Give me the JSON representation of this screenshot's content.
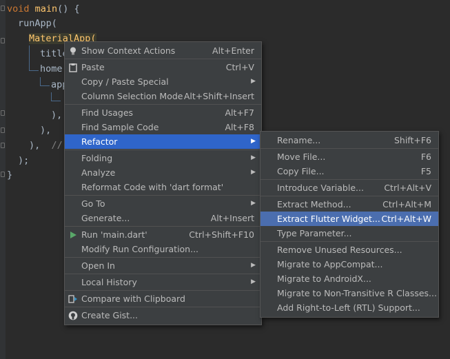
{
  "code": {
    "line1": {
      "kw": "void",
      "fn": "main",
      "rest": "() {"
    },
    "line2": "runApp(",
    "line3": "MaterialApp(",
    "line4": "title",
    "line5": "home",
    "line6": "app",
    "line7": "└",
    "line8": "),",
    "line9": "),",
    "line10": "),",
    "line10_comment": "//",
    "line11": ");",
    "line12": "}"
  },
  "context_menu": {
    "items": [
      {
        "label": "Show Context Actions",
        "shortcut": "Alt+Enter",
        "icon": "lightbulb-icon"
      },
      {
        "label": "Paste",
        "shortcut": "Ctrl+V",
        "icon": "clipboard-icon"
      },
      {
        "label": "Copy / Paste Special",
        "shortcut": ""
      },
      {
        "label": "Column Selection Mode",
        "shortcut": "Alt+Shift+Insert"
      },
      {
        "label": "Find Usages",
        "shortcut": "Alt+F7"
      },
      {
        "label": "Find Sample Code",
        "shortcut": "Alt+F8"
      },
      {
        "label": "Refactor",
        "shortcut": ""
      },
      {
        "label": "Folding",
        "shortcut": ""
      },
      {
        "label": "Analyze",
        "shortcut": ""
      },
      {
        "label": "Reformat Code with 'dart format'",
        "shortcut": ""
      },
      {
        "label": "Go To",
        "shortcut": ""
      },
      {
        "label": "Generate...",
        "shortcut": "Alt+Insert"
      },
      {
        "label": "Run 'main.dart'",
        "shortcut": "Ctrl+Shift+F10",
        "icon": "run-icon"
      },
      {
        "label": "Modify Run Configuration...",
        "shortcut": ""
      },
      {
        "label": "Open In",
        "shortcut": ""
      },
      {
        "label": "Local History",
        "shortcut": ""
      },
      {
        "label": "Compare with Clipboard",
        "shortcut": "",
        "icon": "compare-icon"
      },
      {
        "label": "Create Gist...",
        "shortcut": "",
        "icon": "github-icon"
      }
    ]
  },
  "refactor_menu": {
    "items": [
      {
        "label": "Rename...",
        "shortcut": "Shift+F6"
      },
      {
        "label": "Move File...",
        "shortcut": "F6"
      },
      {
        "label": "Copy File...",
        "shortcut": "F5"
      },
      {
        "label": "Introduce Variable...",
        "shortcut": "Ctrl+Alt+V"
      },
      {
        "label": "Extract Method...",
        "shortcut": "Ctrl+Alt+M"
      },
      {
        "label": "Extract Flutter Widget...",
        "shortcut": "Ctrl+Alt+W"
      },
      {
        "label": "Type Parameter...",
        "shortcut": ""
      },
      {
        "label": "Remove Unused Resources...",
        "shortcut": ""
      },
      {
        "label": "Migrate to AppCompat...",
        "shortcut": ""
      },
      {
        "label": "Migrate to AndroidX...",
        "shortcut": ""
      },
      {
        "label": "Migrate to Non-Transitive R Classes...",
        "shortcut": ""
      },
      {
        "label": "Add Right-to-Left (RTL) Support...",
        "shortcut": ""
      }
    ]
  },
  "colors": {
    "editor_bg": "#2b2b2b",
    "menu_bg": "#3c3f41",
    "selection": "#2f65ca",
    "hover": "#4b6eaf",
    "keyword": "#cc7832",
    "function": "#ffc66d"
  }
}
